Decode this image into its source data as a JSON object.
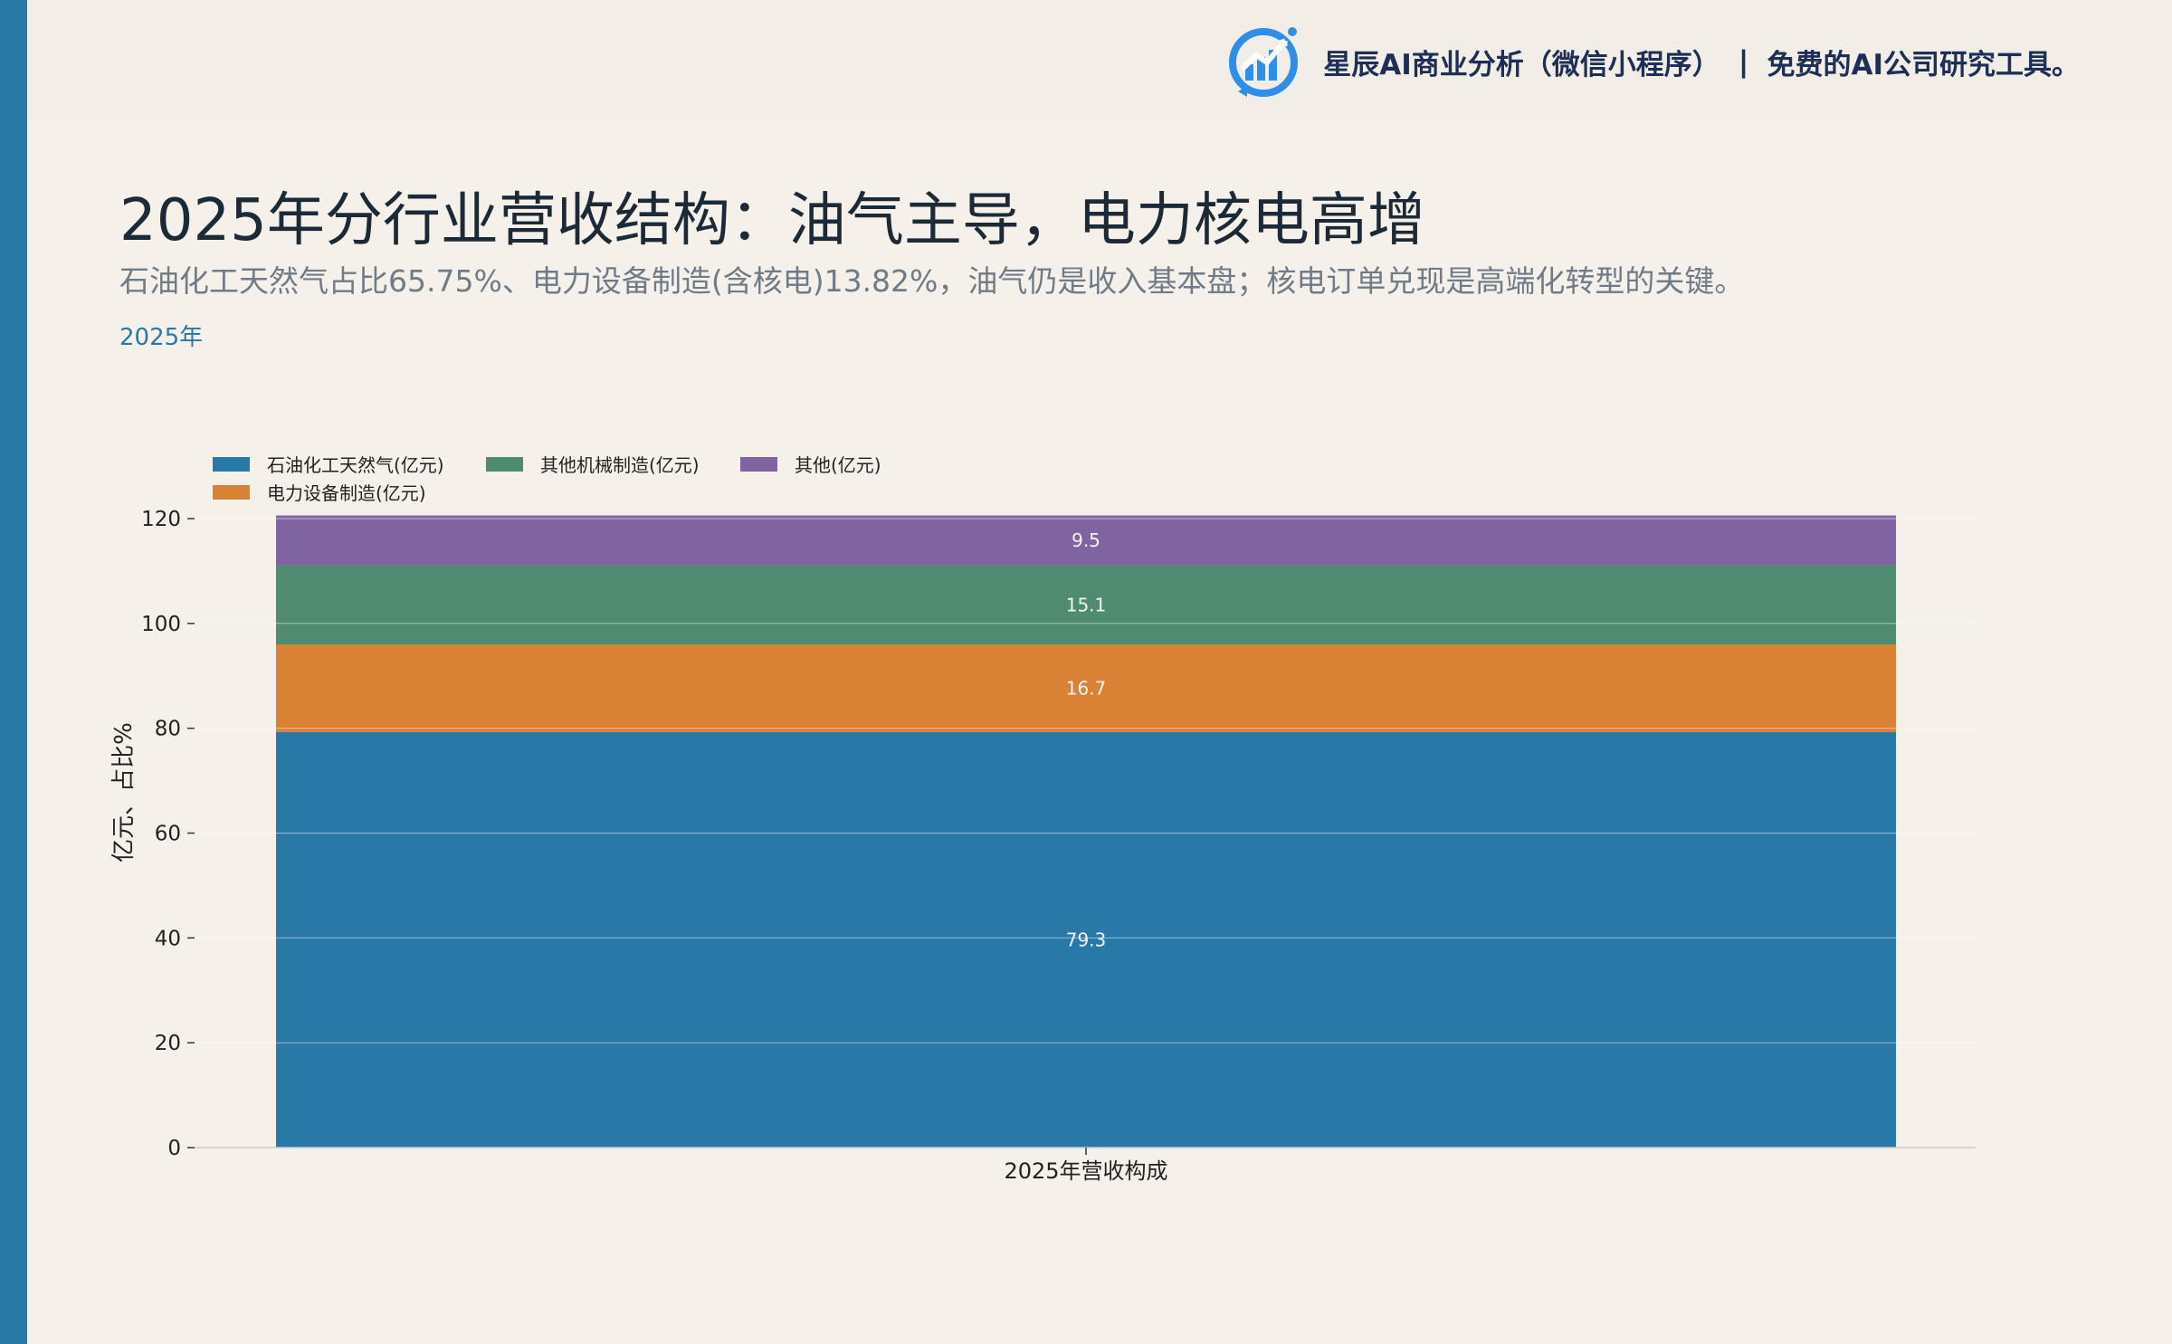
{
  "brand": {
    "name": "星辰AI商业分析（微信小程序）",
    "separator": "|",
    "tagline": "免费的AI公司研究工具。"
  },
  "header": {
    "title": "2025年分行业营收结构：油气主导，电力核电高增",
    "subtitle": "石油化工天然气占比65.75%、电力设备制造(含核电)13.82%，油气仍是收入基本盘；核电订单兑现是高端化转型的关键。",
    "period": "2025年"
  },
  "colors": {
    "accent": "#2a78a8",
    "background": "#f5f1ea"
  },
  "chart_data": {
    "type": "bar",
    "stacked": true,
    "categories": [
      "2025年营收构成"
    ],
    "series": [
      {
        "name": "石油化工天然气(亿元)",
        "values": [
          79.3
        ],
        "color": "#2878a8"
      },
      {
        "name": "电力设备制造(亿元)",
        "values": [
          16.7
        ],
        "color": "#d98236"
      },
      {
        "name": "其他机械制造(亿元)",
        "values": [
          15.1
        ],
        "color": "#4e8b6f"
      },
      {
        "name": "其他(亿元)",
        "values": [
          9.5
        ],
        "color": "#8064a2"
      }
    ],
    "data_labels": [
      "79.3",
      "16.7",
      "15.1",
      "9.5"
    ],
    "ylabel": "亿元、占比%",
    "ylim": [
      0,
      120
    ],
    "yticks": [
      0,
      20,
      40,
      60,
      80,
      100,
      120
    ],
    "grid": true,
    "legend_position": "top-left"
  }
}
